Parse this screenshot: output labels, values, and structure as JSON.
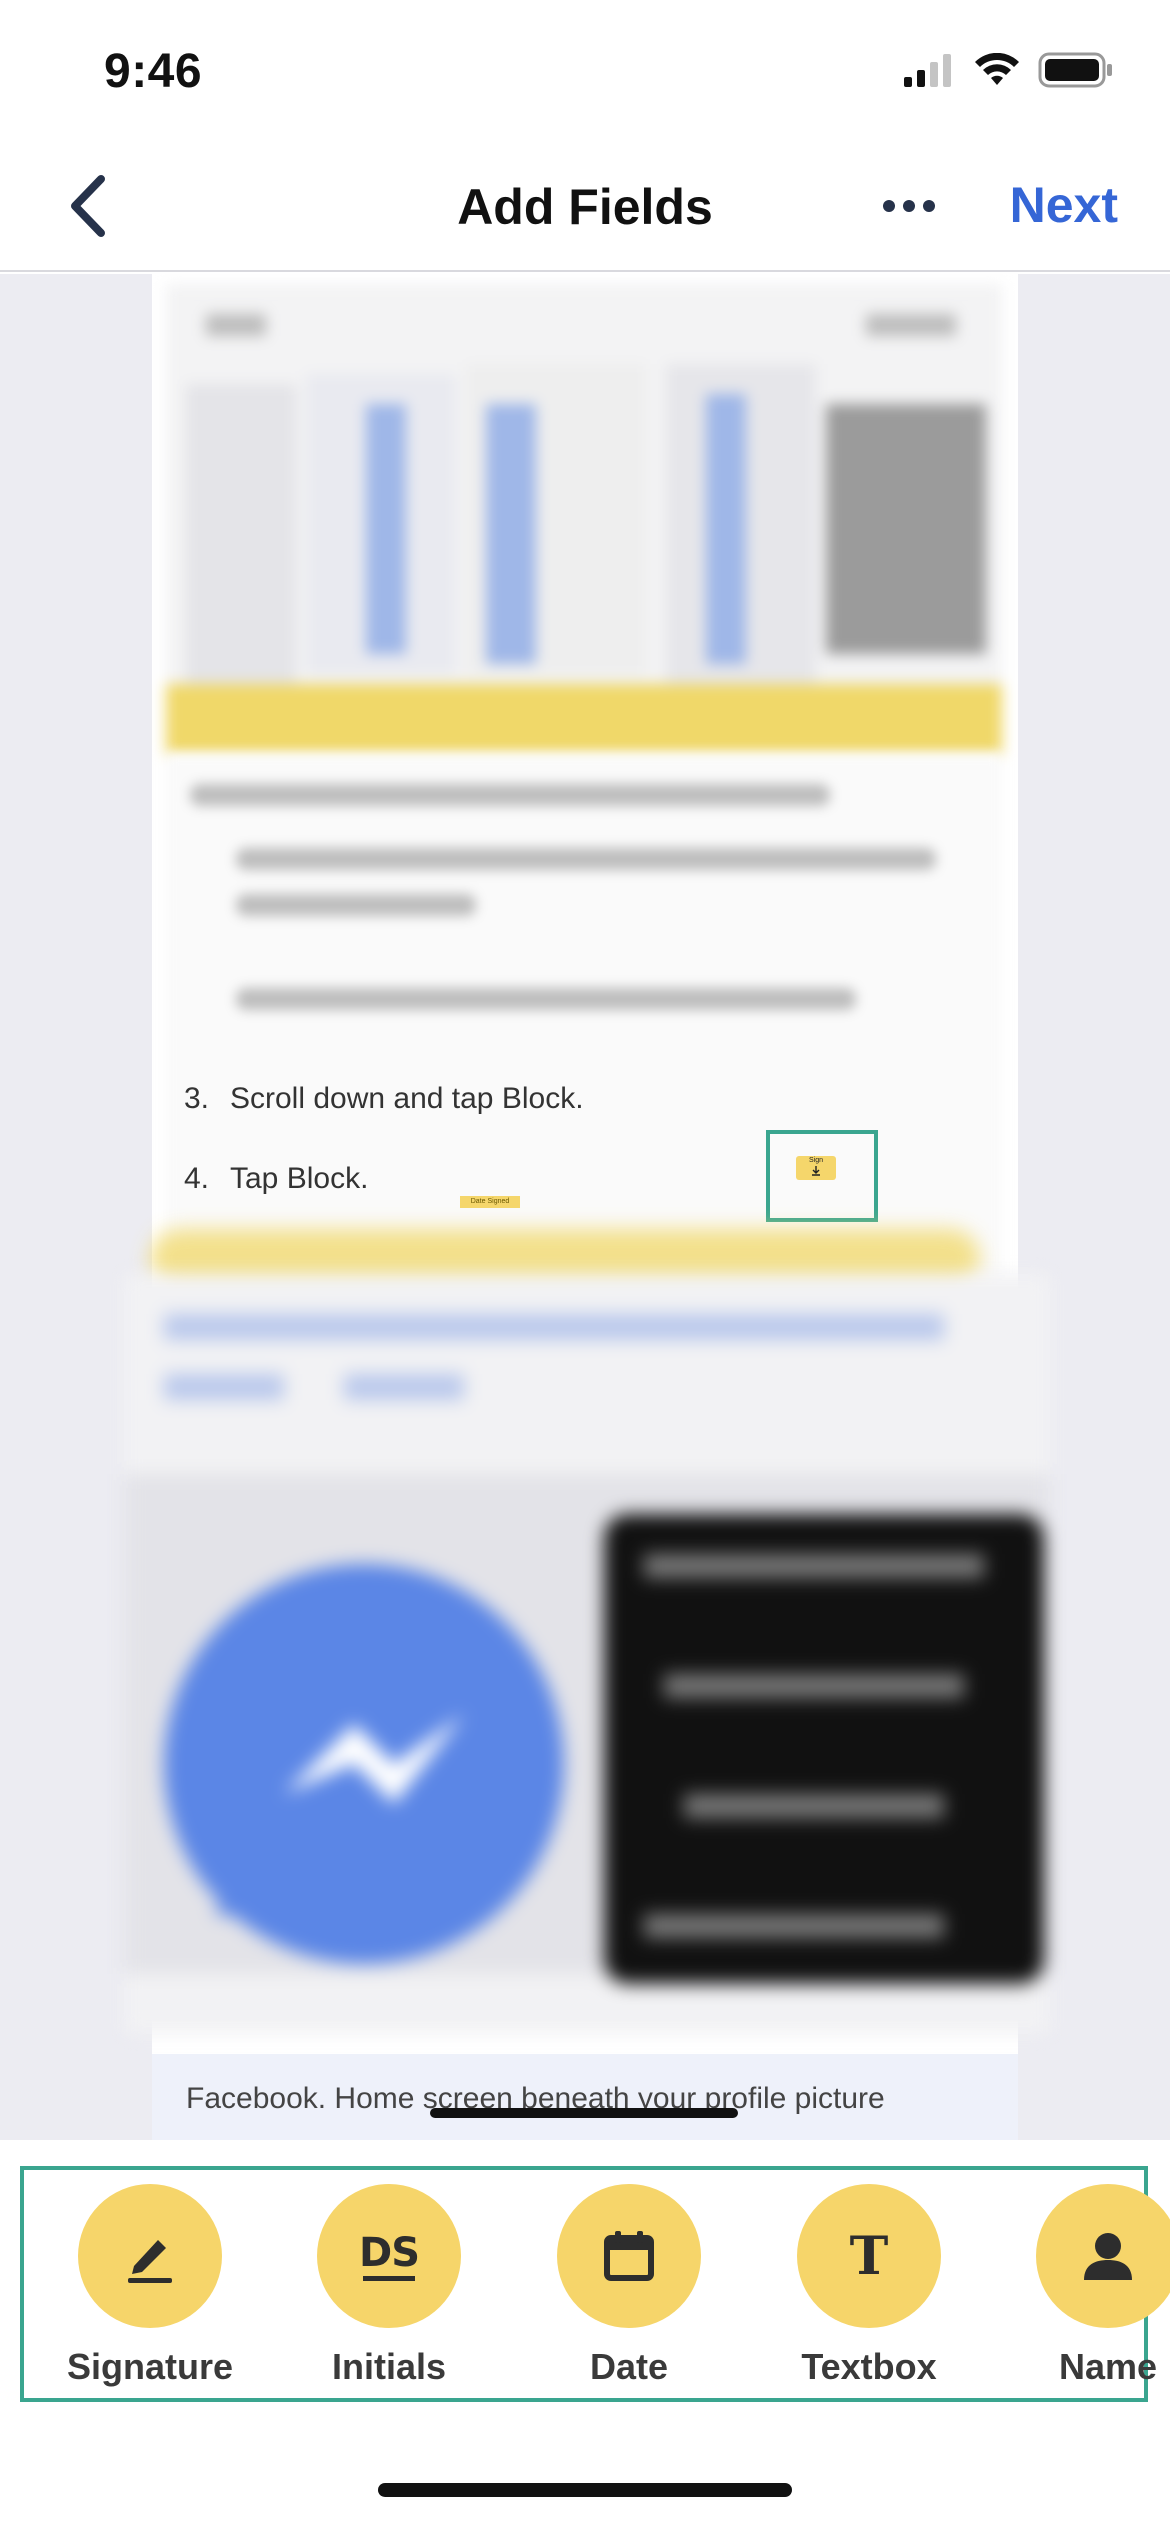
{
  "status_bar": {
    "time": "9:46"
  },
  "nav": {
    "title": "Add Fields",
    "next_label": "Next"
  },
  "document": {
    "steps": [
      {
        "number": "3.",
        "text": "Scroll down and tap Block."
      },
      {
        "number": "4.",
        "text": "Tap Block."
      }
    ],
    "date_field_label": "Date Signed",
    "sign_field_label": "Sign",
    "footer_text": "Facebook. Home screen beneath your profile picture"
  },
  "toolbar": {
    "tools": [
      {
        "label": "Signature",
        "icon": "pen-icon"
      },
      {
        "label": "Initials",
        "icon": "initials-icon",
        "glyph": "DS"
      },
      {
        "label": "Date",
        "icon": "calendar-icon"
      },
      {
        "label": "Textbox",
        "icon": "text-icon",
        "glyph": "T"
      },
      {
        "label": "Name",
        "icon": "person-icon"
      }
    ]
  },
  "colors": {
    "accent": "#3566d6",
    "field_yellow": "#f6d56a",
    "selection_teal": "#3aa58f"
  }
}
